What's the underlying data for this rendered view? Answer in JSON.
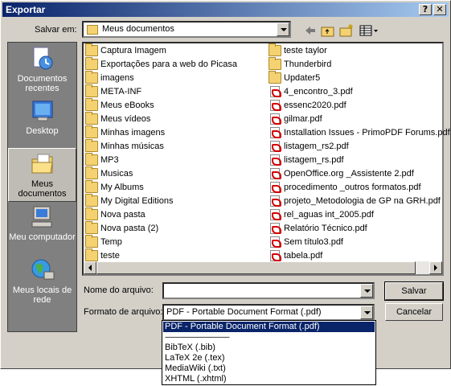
{
  "window": {
    "title": "Exportar",
    "help_glyph": "?",
    "close_glyph": "✕"
  },
  "toolbar": {
    "save_in_label": "Salvar em:",
    "save_in_value": "Meus documentos"
  },
  "places": [
    {
      "label": "Documentos recentes",
      "icon": "recent-documents-icon",
      "selected": false
    },
    {
      "label": "Desktop",
      "icon": "desktop-icon",
      "selected": false
    },
    {
      "label": "Meus documentos",
      "icon": "my-documents-icon",
      "selected": true
    },
    {
      "label": "Meu computador",
      "icon": "my-computer-icon",
      "selected": false
    },
    {
      "label": "Meus locais de rede",
      "icon": "network-places-icon",
      "selected": false
    }
  ],
  "files": {
    "col1": [
      {
        "name": "Captura Imagem",
        "type": "folder"
      },
      {
        "name": "Exportações para a web do Picasa",
        "type": "folder"
      },
      {
        "name": "imagens",
        "type": "folder"
      },
      {
        "name": "META-INF",
        "type": "folder"
      },
      {
        "name": "Meus eBooks",
        "type": "folder"
      },
      {
        "name": "Meus vídeos",
        "type": "folder"
      },
      {
        "name": "Minhas imagens",
        "type": "folder"
      },
      {
        "name": "Minhas músicas",
        "type": "folder"
      },
      {
        "name": "MP3",
        "type": "folder"
      },
      {
        "name": "Musicas",
        "type": "folder"
      },
      {
        "name": "My Albums",
        "type": "folder"
      },
      {
        "name": "My Digital Editions",
        "type": "folder"
      },
      {
        "name": "Nova pasta",
        "type": "folder"
      },
      {
        "name": "Nova pasta (2)",
        "type": "folder"
      },
      {
        "name": "Temp",
        "type": "folder"
      },
      {
        "name": "teste",
        "type": "folder"
      }
    ],
    "col2": [
      {
        "name": "teste taylor",
        "type": "folder"
      },
      {
        "name": "Thunderbird",
        "type": "folder"
      },
      {
        "name": "Updater5",
        "type": "folder"
      },
      {
        "name": "4_encontro_3.pdf",
        "type": "pdf"
      },
      {
        "name": "essenc2020.pdf",
        "type": "pdf"
      },
      {
        "name": "gilmar.pdf",
        "type": "pdf"
      },
      {
        "name": "Installation Issues - PrimoPDF Forums.pdf",
        "type": "pdf"
      },
      {
        "name": "listagem_rs2.pdf",
        "type": "pdf"
      },
      {
        "name": "listagem_rs.pdf",
        "type": "pdf"
      },
      {
        "name": "OpenOffice.org _Assistente 2.pdf",
        "type": "pdf"
      },
      {
        "name": "procedimento _outros formatos.pdf",
        "type": "pdf"
      },
      {
        "name": "projeto_Metodologia de GP na GRH.pdf",
        "type": "pdf"
      },
      {
        "name": "rel_aguas int_2005.pdf",
        "type": "pdf"
      },
      {
        "name": "Relatório Técnico.pdf",
        "type": "pdf"
      },
      {
        "name": "Sem título3.pdf",
        "type": "pdf"
      },
      {
        "name": "tabela.pdf",
        "type": "pdf"
      }
    ]
  },
  "form": {
    "filename_label": "Nome do arquivo:",
    "filename_value": "",
    "format_label": "Formato de arquivo:",
    "format_value": "PDF - Portable Document Format (.pdf)"
  },
  "buttons": {
    "save": "Salvar",
    "cancel": "Cancelar"
  },
  "format_options": [
    {
      "label": "PDF - Portable Document Format (.pdf)",
      "selected": true
    },
    {
      "label": "----------------------------------------",
      "selected": false
    },
    {
      "label": "BibTeX (.bib)",
      "selected": false
    },
    {
      "label": "LaTeX 2e (.tex)",
      "selected": false
    },
    {
      "label": "MediaWiki (.txt)",
      "selected": false
    },
    {
      "label": "XHTML (.xhtml)",
      "selected": false
    }
  ]
}
